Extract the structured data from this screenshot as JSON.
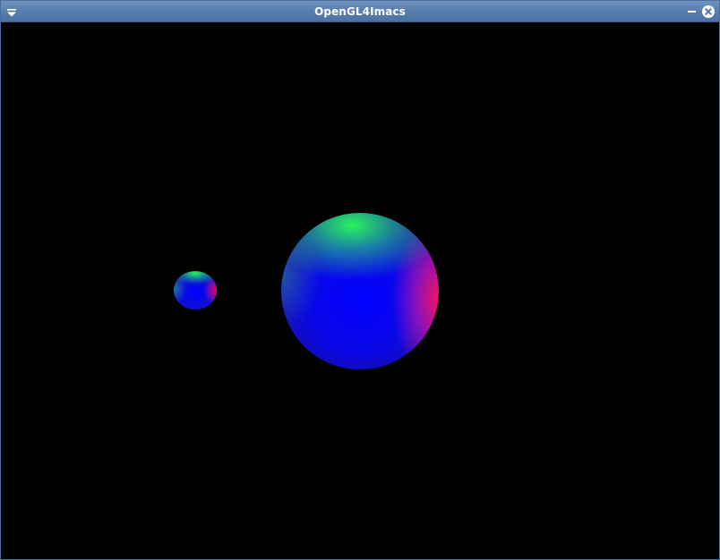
{
  "window": {
    "title": "OpenGL4Imacs",
    "background_color": "#000000",
    "titlebar_color": "#5a80b0"
  },
  "titlebar_icons": {
    "menu": "window-menu-icon",
    "minimize": "minimize-icon",
    "close": "close-icon"
  },
  "scene": {
    "objects": [
      "large-sphere",
      "small-sphere"
    ]
  }
}
